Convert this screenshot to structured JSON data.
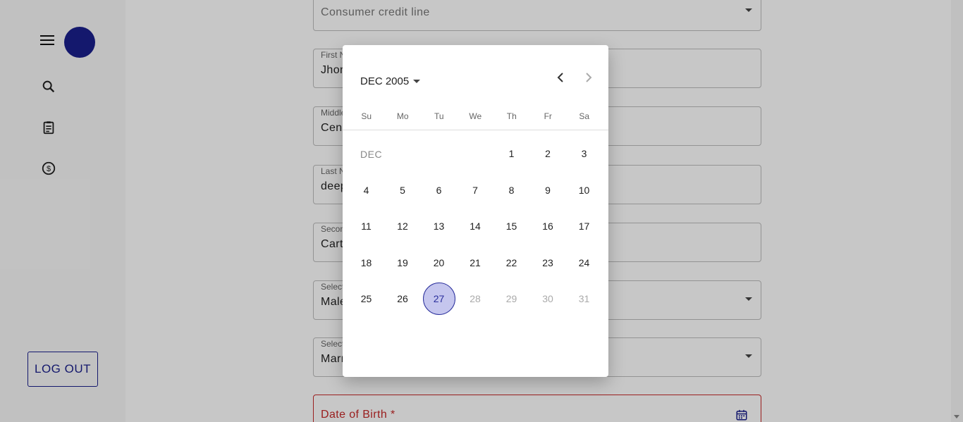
{
  "sidebar": {
    "logout_label": "LOG OUT",
    "icons": [
      "menu-icon",
      "search-icon",
      "clipboard-icon",
      "dollar-icon"
    ]
  },
  "form": {
    "product": {
      "value": "Consumer credit line"
    },
    "first_name": {
      "label": "First Name *",
      "value": "Jhon"
    },
    "middle_name": {
      "label": "Middle Name",
      "value": "Cena"
    },
    "last_name": {
      "label": "Last Name *",
      "value": "deep"
    },
    "second_last_name": {
      "label": "Second Last Name",
      "value": "Cartagena"
    },
    "gender": {
      "label": "Select your gender *",
      "value": "Male"
    },
    "marital_status": {
      "label": "Select your Marital Status *",
      "value": "Married"
    },
    "dob": {
      "label": "Date of Birth *"
    }
  },
  "picker": {
    "month_year": "DEC 2005",
    "month_tag": "DEC",
    "weekdays": [
      "Su",
      "Mo",
      "Tu",
      "We",
      "Th",
      "Fr",
      "Sa"
    ],
    "days": [
      {
        "n": "1",
        "col": 4,
        "row": 0,
        "muted": false
      },
      {
        "n": "2",
        "col": 5,
        "row": 0,
        "muted": false
      },
      {
        "n": "3",
        "col": 6,
        "row": 0,
        "muted": false
      },
      {
        "n": "4",
        "col": 0,
        "row": 1,
        "muted": false
      },
      {
        "n": "5",
        "col": 1,
        "row": 1,
        "muted": false
      },
      {
        "n": "6",
        "col": 2,
        "row": 1,
        "muted": false
      },
      {
        "n": "7",
        "col": 3,
        "row": 1,
        "muted": false
      },
      {
        "n": "8",
        "col": 4,
        "row": 1,
        "muted": false
      },
      {
        "n": "9",
        "col": 5,
        "row": 1,
        "muted": false
      },
      {
        "n": "10",
        "col": 6,
        "row": 1,
        "muted": false
      },
      {
        "n": "11",
        "col": 0,
        "row": 2,
        "muted": false
      },
      {
        "n": "12",
        "col": 1,
        "row": 2,
        "muted": false
      },
      {
        "n": "13",
        "col": 2,
        "row": 2,
        "muted": false
      },
      {
        "n": "14",
        "col": 3,
        "row": 2,
        "muted": false
      },
      {
        "n": "15",
        "col": 4,
        "row": 2,
        "muted": false
      },
      {
        "n": "16",
        "col": 5,
        "row": 2,
        "muted": false
      },
      {
        "n": "17",
        "col": 6,
        "row": 2,
        "muted": false
      },
      {
        "n": "18",
        "col": 0,
        "row": 3,
        "muted": false
      },
      {
        "n": "19",
        "col": 1,
        "row": 3,
        "muted": false
      },
      {
        "n": "20",
        "col": 2,
        "row": 3,
        "muted": false
      },
      {
        "n": "21",
        "col": 3,
        "row": 3,
        "muted": false
      },
      {
        "n": "22",
        "col": 4,
        "row": 3,
        "muted": false
      },
      {
        "n": "23",
        "col": 5,
        "row": 3,
        "muted": false
      },
      {
        "n": "24",
        "col": 6,
        "row": 3,
        "muted": false
      },
      {
        "n": "25",
        "col": 0,
        "row": 4,
        "muted": false
      },
      {
        "n": "26",
        "col": 1,
        "row": 4,
        "muted": false
      },
      {
        "n": "27",
        "col": 2,
        "row": 4,
        "muted": false,
        "selected": true
      },
      {
        "n": "28",
        "col": 3,
        "row": 4,
        "muted": true
      },
      {
        "n": "29",
        "col": 4,
        "row": 4,
        "muted": true
      },
      {
        "n": "30",
        "col": 5,
        "row": 4,
        "muted": true
      },
      {
        "n": "31",
        "col": 6,
        "row": 4,
        "muted": true
      }
    ]
  },
  "colors": {
    "accent": "#1a1f8c",
    "selected_bg": "#c5c6ee",
    "error": "#c62828"
  }
}
